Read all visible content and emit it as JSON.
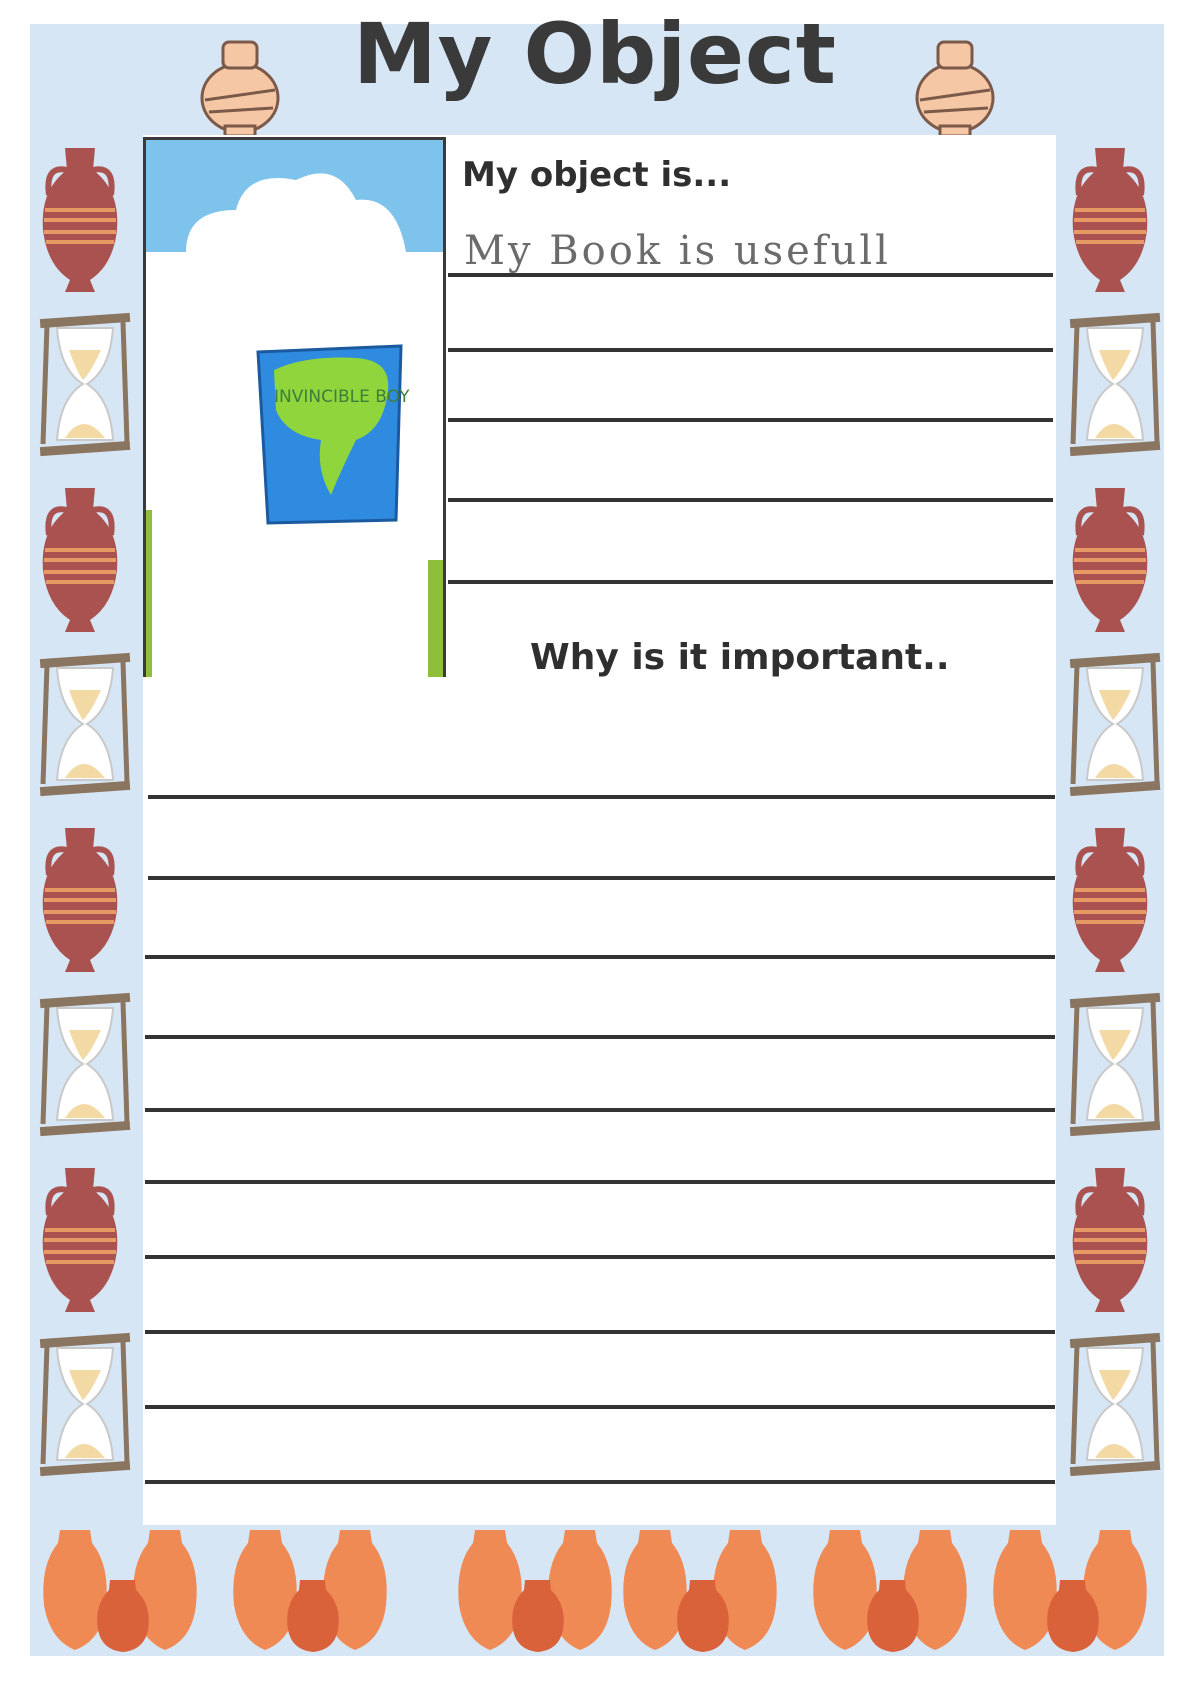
{
  "worksheet": {
    "title": "My Object",
    "prompt_object": "My object is...",
    "answer_object": "My Book is usefull",
    "prompt_importance": "Why is it  important..",
    "drawing_book_text": "INVINCIBLE BOY"
  },
  "colors": {
    "border_background": "#d7e6f5",
    "vase_red": "#a9524f",
    "vase_stripe": "#e79a63",
    "orange_pot": "#f08a55",
    "hourglass_frame": "#8a7560",
    "sand": "#f3d9a4",
    "ink": "#333333"
  },
  "icons": [
    "vase-icon",
    "hourglass-icon",
    "broken-pot-icon",
    "orange-pot-icon"
  ]
}
